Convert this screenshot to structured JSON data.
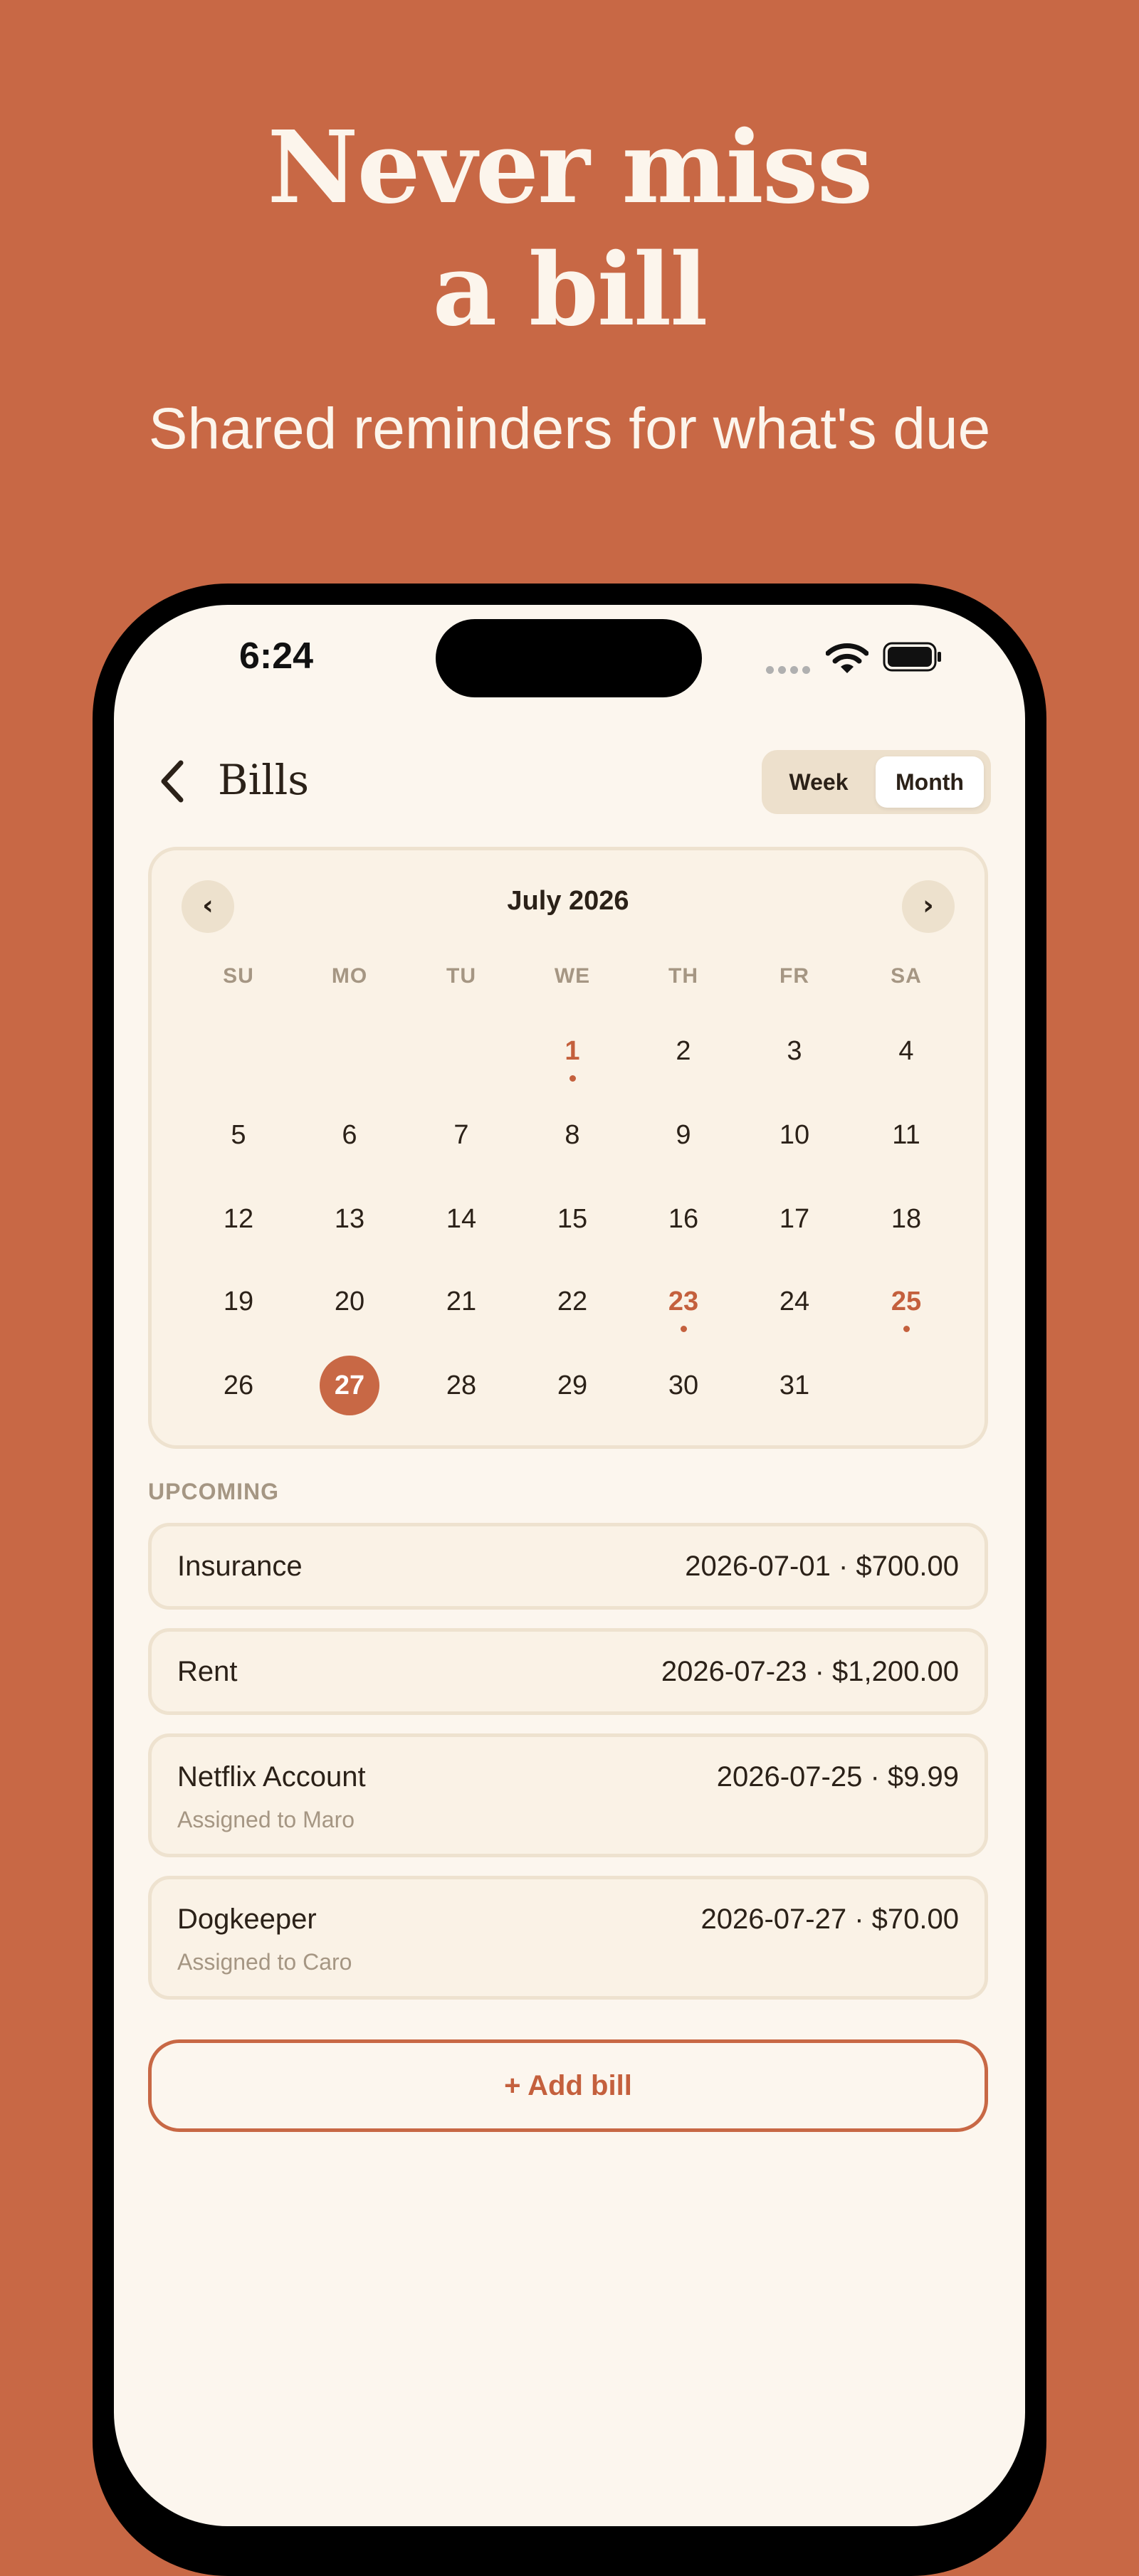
{
  "hero": {
    "title_line1": "Never miss",
    "title_line2": "a bill",
    "subtitle": "Shared reminders for what's due"
  },
  "status_bar": {
    "time": "6:24",
    "icons": [
      "cellular-signal-icon",
      "wifi-icon",
      "battery-icon"
    ]
  },
  "nav": {
    "back_icon": "chevron-left-icon",
    "title": "Bills",
    "view_options": [
      "Week",
      "Month"
    ],
    "selected_view": "Month"
  },
  "calendar": {
    "month_label": "July 2026",
    "prev_icon": "‹",
    "next_icon": "›",
    "weekdays": [
      "SU",
      "MO",
      "TU",
      "WE",
      "TH",
      "FR",
      "SA"
    ],
    "first_weekday_index": 3,
    "days_in_month": 31,
    "today": 27,
    "due_days": [
      1,
      23,
      25
    ]
  },
  "upcoming": {
    "label": "UPCOMING",
    "bills": [
      {
        "name": "Insurance",
        "meta": "2026-07-01 · $700.00",
        "assignee": ""
      },
      {
        "name": "Rent",
        "meta": "2026-07-23 · $1,200.00",
        "assignee": ""
      },
      {
        "name": "Netflix Account",
        "meta": "2026-07-25 · $9.99",
        "assignee": "Assigned to Maro"
      },
      {
        "name": "Dogkeeper",
        "meta": "2026-07-27 · $70.00",
        "assignee": "Assigned to Caro"
      }
    ]
  },
  "add_bill_label": "+ Add bill",
  "colors": {
    "background": "#C86845",
    "screen": "#FCF6EE",
    "accent": "#C4603D",
    "muted_text": "#A59683"
  }
}
